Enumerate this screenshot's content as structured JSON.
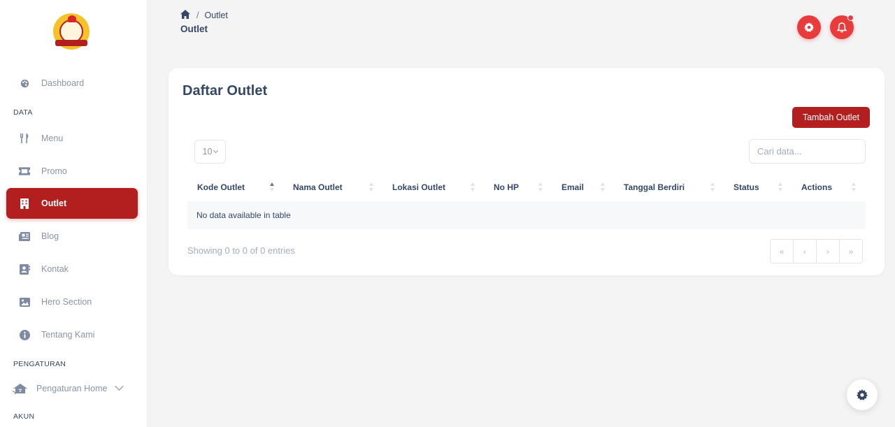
{
  "sidebar": {
    "logo_name": "chicken-mascot-logo",
    "sections": {
      "data": "DATA",
      "pengaturan": "PENGATURAN",
      "akun": "AKUN"
    },
    "items": [
      {
        "label": "Dashboard",
        "icon": "palette-icon"
      },
      {
        "label": "Menu",
        "icon": "utensils-icon"
      },
      {
        "label": "Promo",
        "icon": "ticket-icon"
      },
      {
        "label": "Outlet",
        "icon": "building-icon",
        "active": true
      },
      {
        "label": "Blog",
        "icon": "newspaper-icon"
      },
      {
        "label": "Kontak",
        "icon": "contact-book-icon"
      },
      {
        "label": "Hero Section",
        "icon": "image-icon"
      },
      {
        "label": "Tentang Kami",
        "icon": "info-circle-icon"
      },
      {
        "label": "Pengaturan Home",
        "icon": "home-wifi-icon"
      }
    ]
  },
  "header": {
    "breadcrumb_sep": "/",
    "breadcrumb_current": "Outlet",
    "title": "Outlet"
  },
  "card": {
    "title": "Daftar Outlet",
    "add_button": "Tambah Outlet",
    "length_value": "10",
    "search_placeholder": "Cari data...",
    "columns": [
      "Kode Outlet",
      "Nama Outlet",
      "Lokasi Outlet",
      "No HP",
      "Email",
      "Tanggal Berdiri",
      "Status",
      "Actions"
    ],
    "empty_text": "No data available in table",
    "info": "Showing 0 to 0 of 0 entries",
    "pager": [
      "«",
      "‹",
      "›",
      "»"
    ]
  },
  "colors": {
    "primary": "#b31f1f",
    "accent": "#e83b3b",
    "text": "#344767",
    "muted": "#8a94a6"
  }
}
